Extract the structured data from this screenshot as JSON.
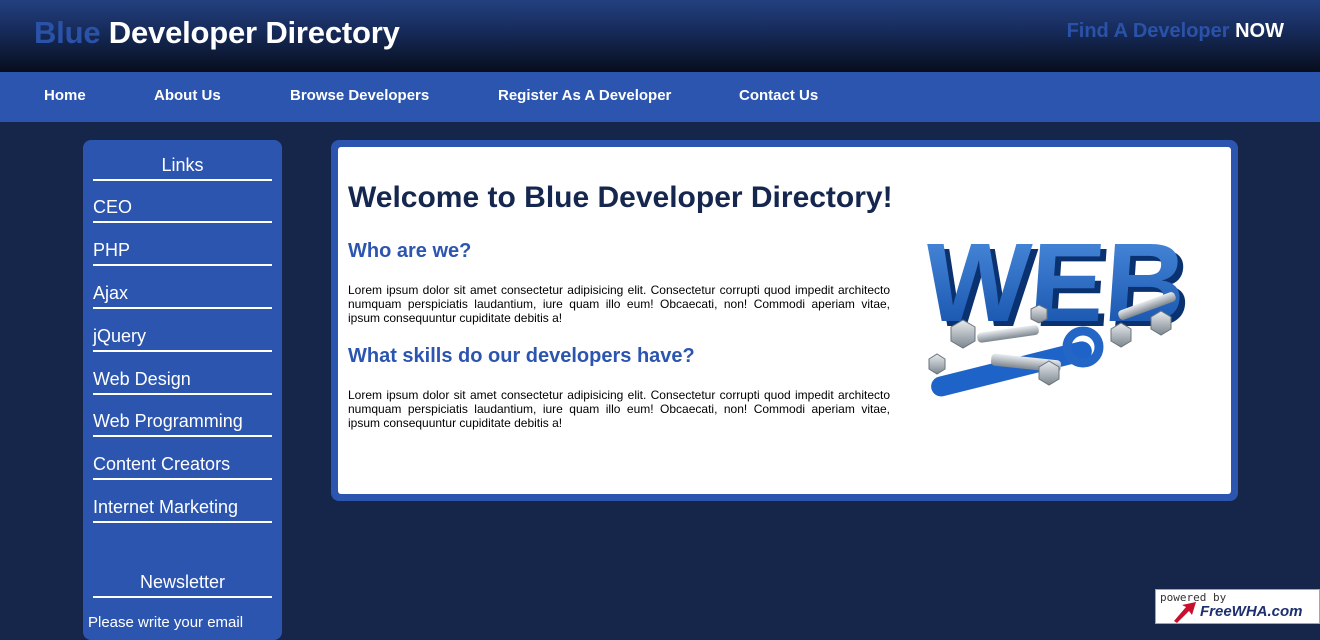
{
  "header": {
    "title_accent": "Blue",
    "title_rest": " Developer Directory",
    "tagline_prefix": "Find A Developer ",
    "tagline_strong": "NOW"
  },
  "nav": {
    "items": [
      "Home",
      "About Us",
      "Browse Developers",
      "Register As A Developer",
      "Contact Us"
    ]
  },
  "sidebar": {
    "links_heading": "Links",
    "links": [
      "CEO",
      "PHP",
      "Ajax",
      "jQuery",
      "Web Design",
      "Web Programming",
      "Content Creators",
      "Internet Marketing"
    ],
    "newsletter_heading": "Newsletter",
    "newsletter_text": "Please write your email"
  },
  "main": {
    "welcome": "Welcome to Blue Developer Directory!",
    "section1_heading": "Who are we?",
    "section1_text": "Lorem ipsum dolor sit amet consectetur adipisicing elit. Consectetur corrupti quod impedit architecto numquam perspiciatis laudantium, iure quam illo eum! Obcaecati, non! Commodi aperiam vitae, ipsum consequuntur cupiditate debitis a!",
    "section2_heading": "What skills do our developers have?",
    "section2_text": "Lorem ipsum dolor sit amet consectetur adipisicing elit. Consectetur corrupti quod impedit architecto numquam perspiciatis laudantium, iure quam illo eum! Obcaecati, non! Commodi aperiam vitae, ipsum consequuntur cupiditate debitis a!",
    "image_text": "WEB"
  },
  "badge": {
    "small": "powered by",
    "brand": "FreeWHA.com"
  },
  "colors": {
    "accent": "#2c55b0",
    "background": "#16254a",
    "heading": "#15274f"
  }
}
